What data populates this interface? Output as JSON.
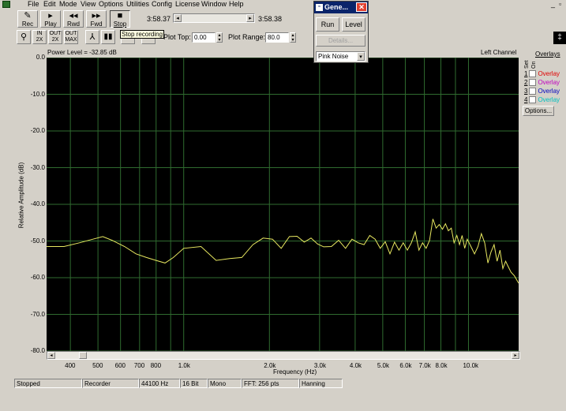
{
  "menu": {
    "items": [
      "File",
      "Edit",
      "Mode",
      "View",
      "Options",
      "Utilities",
      "Config",
      "License",
      "Window",
      "Help"
    ]
  },
  "transport": {
    "rec": "Rec",
    "play": "Play",
    "rwd": "Rwd",
    "fwd": "Fwd",
    "stop": "Stop",
    "time_left": "3:58.37",
    "time_right": "3:58.38"
  },
  "toolbar2": {
    "tooltip": "Stop recording",
    "plot_top_label": "Plot Top:",
    "plot_top_value": "0.00",
    "plot_range_label": "Plot Range:",
    "plot_range_value": "80.0"
  },
  "plot": {
    "power_level": "Power Level = -32.85 dB",
    "channel": "Left Channel",
    "ylabel": "Relative Amplitude (dB)",
    "xlabel": "Frequency (Hz)"
  },
  "chart_data": {
    "type": "line",
    "ylabel": "Relative Amplitude (dB)",
    "xlabel": "Frequency (Hz)",
    "ylim": [
      -80,
      0
    ],
    "xscale": "log",
    "xlim": [
      330,
      15000
    ],
    "yticks": [
      "0.0",
      "-10.0",
      "-20.0",
      "-30.0",
      "-40.0",
      "-50.0",
      "-60.0",
      "-70.0",
      "-80.0"
    ],
    "xticks": [
      "400",
      "500",
      "600",
      "700",
      "800",
      "1.0k",
      "2.0k",
      "3.0k",
      "4.0k",
      "5.0k",
      "6.0k",
      "7.0k",
      "8.0k",
      "10.0k"
    ],
    "grid": true,
    "series": [
      {
        "color": "#e8e860",
        "x": [
          330,
          380,
          430,
          480,
          520,
          560,
          620,
          680,
          740,
          800,
          860,
          920,
          1000,
          1150,
          1300,
          1450,
          1600,
          1750,
          1900,
          2050,
          2200,
          2350,
          2500,
          2650,
          2800,
          2950,
          3100,
          3300,
          3500,
          3700,
          3900,
          4100,
          4300,
          4500,
          4700,
          4900,
          5100,
          5300,
          5500,
          5700,
          5900,
          6100,
          6300,
          6500,
          6700,
          6900,
          7100,
          7300,
          7500,
          7700,
          7900,
          8100,
          8300,
          8500,
          8700,
          8900,
          9100,
          9300,
          9500,
          9700,
          9900,
          10200,
          10500,
          10800,
          11100,
          11400,
          11700,
          12000,
          12300,
          12600,
          12900,
          13200,
          13500,
          13800,
          14100,
          14500,
          15000
        ],
        "y": [
          -51.5,
          -51.5,
          -50.5,
          -49.5,
          -48.8,
          -49.8,
          -51.5,
          -53.5,
          -54.5,
          -55.3,
          -56,
          -54.5,
          -52,
          -51.5,
          -55.3,
          -54.8,
          -54.5,
          -51,
          -49.2,
          -49.5,
          -52,
          -48.8,
          -48.7,
          -50.3,
          -49.2,
          -50.8,
          -51.6,
          -51.5,
          -49.8,
          -52,
          -49.5,
          -50.5,
          -51,
          -48.5,
          -49.5,
          -52,
          -50.2,
          -53.5,
          -50.3,
          -52.5,
          -50.5,
          -52.5,
          -50.5,
          -47.5,
          -52.5,
          -50.5,
          -52,
          -49.8,
          -44,
          -46.5,
          -45.5,
          -46.8,
          -45.3,
          -47.2,
          -46.5,
          -50.5,
          -48.5,
          -51,
          -48.5,
          -52,
          -49.5,
          -51.5,
          -53.5,
          -51.5,
          -48,
          -50.5,
          -56,
          -53,
          -51,
          -55.5,
          -52.5,
          -57.5,
          -55.5,
          -57,
          -58.5,
          -59.5,
          -61.5
        ]
      }
    ]
  },
  "overlays": {
    "title": "Overlays",
    "col_set": "Set",
    "col_on": "On",
    "items": [
      {
        "num": "1",
        "label": "Overlay",
        "color": "#e00000"
      },
      {
        "num": "2",
        "label": "Overlay",
        "color": "#c000c0"
      },
      {
        "num": "3",
        "label": "Overlay",
        "color": "#0000c0"
      },
      {
        "num": "4",
        "label": "Overlay",
        "color": "#00c0c0"
      }
    ],
    "options": "Options..."
  },
  "status": {
    "state": "Stopped",
    "mode": "Recorder",
    "rate": "44100 Hz",
    "bits": "16 Bit",
    "channels": "Mono",
    "fft": "FFT: 256 pts",
    "window": "Hanning"
  },
  "generator": {
    "title": "Gene...",
    "run": "Run",
    "level": "Level",
    "details": "Details...",
    "signal": "Pink Noise"
  }
}
